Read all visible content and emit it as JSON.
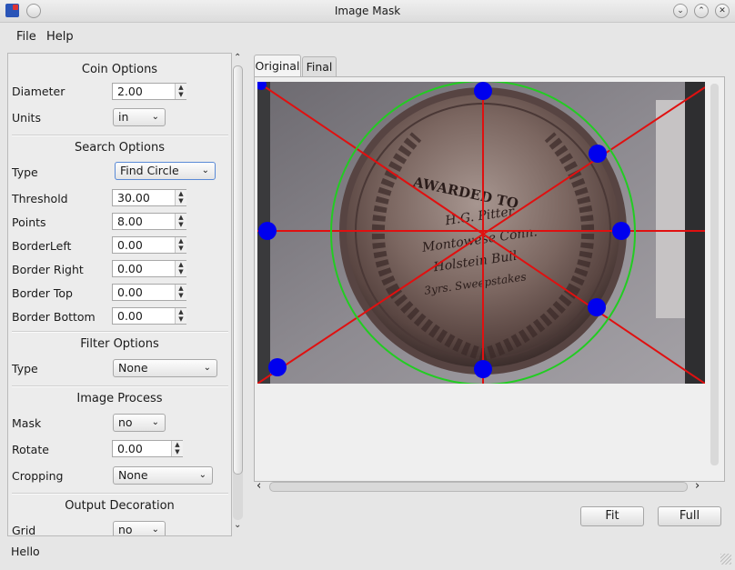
{
  "window": {
    "title": "Image Mask"
  },
  "menu": {
    "file": "File",
    "help": "Help"
  },
  "coin_options": {
    "title": "Coin Options",
    "diameter_label": "Diameter",
    "diameter_value": "2.00",
    "units_label": "Units",
    "units_value": "in"
  },
  "search_options": {
    "title": "Search Options",
    "type_label": "Type",
    "type_value": "Find Circle",
    "threshold_label": "Threshold",
    "threshold_value": "30.00",
    "points_label": "Points",
    "points_value": "8.00",
    "border_left_label": "BorderLeft",
    "border_left_value": "0.00",
    "border_right_label": "Border Right",
    "border_right_value": "0.00",
    "border_top_label": "Border Top",
    "border_top_value": "0.00",
    "border_bottom_label": "Border Bottom",
    "border_bottom_value": "0.00"
  },
  "filter_options": {
    "title": "Filter Options",
    "type_label": "Type",
    "type_value": "None"
  },
  "image_process": {
    "title": "Image Process",
    "mask_label": "Mask",
    "mask_value": "no",
    "rotate_label": "Rotate",
    "rotate_value": "0.00",
    "cropping_label": "Cropping",
    "cropping_value": "None"
  },
  "output_decoration": {
    "title": "Output Decoration",
    "grid_label": "Grid",
    "grid_value": "no"
  },
  "tabs": {
    "original": "Original",
    "final": "Final"
  },
  "medal_text": {
    "line1": "AWARDED TO",
    "line2": "H.G. Pitter",
    "line3": "Montowese Conn.",
    "line4": "Holstein Bull",
    "line5": "3yrs. Sweepstakes"
  },
  "buttons": {
    "fit": "Fit",
    "full": "Full"
  },
  "status": {
    "text": "Hello"
  },
  "colors": {
    "circle": "#22cc22",
    "lines": "#e01010",
    "points": "#0000ee"
  }
}
